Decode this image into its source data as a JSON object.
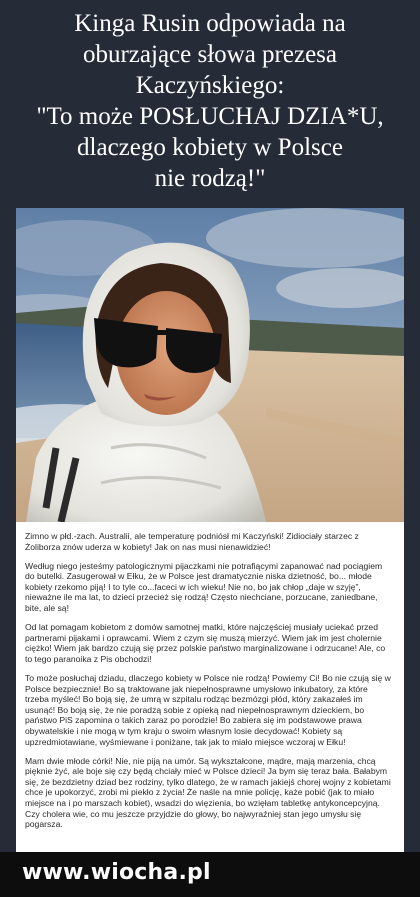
{
  "headline": {
    "lines": [
      "Kinga Rusin odpowiada na",
      "oburzające słowa prezesa",
      "Kaczyńskiego:",
      "\"To może POSŁUCHAJ DZIA*U,",
      "dlaczego kobiety w Polsce",
      "nie rodzą!\""
    ]
  },
  "post": {
    "paragraphs": [
      "Zimno w płd.-zach. Australii, ale temperaturę podniósł mi Kaczyński! Zidiociały starzec z Żoliborza znów uderza w kobiety! Jak on nas musi nienawidzieć!",
      "Według niego jesteśmy patologicznymi pijaczkami nie potrafiącymi zapanować nad pociągiem do butelki. Zasugerował w Ełku, że w Polsce jest dramatycznie niska dzietność, bo... młode kobiety rzekomo piją! I to tyle co...faceci w ich wieku! Nie no, bo jak chłop „daje w szyję”, nieważne ile ma lat, to dzieci przecież się rodzą! Często niechciane, porzucane, zaniedbane, bite, ale są!",
      "Od lat pomagam kobietom z domów samotnej matki, które najczęściej musiały uciekać przed partnerami pijakami i oprawcami. Wiem z czym się muszą mierzyć. Wiem jak im jest cholernie ciężko! Wiem jak bardzo czują się przez polskie państwo marginalizowane i odrzucane! Ale, co to tego paranoika z Pis obchodzi!",
      "To może posłuchaj dziadu, dlaczego kobiety w Polsce nie rodzą! Powiemy Ci! Bo nie czują się w Polsce bezpiecznie! Bo są traktowane jak niepełnosprawne umysłowo inkubatory, za które trzeba myśleć! Bo boją się, że umrą w szpitalu rodząc bezmózgi płód, który zakazałeś im usunąć! Bo boją się, że nie poradzą sobie z opieką nad niepełnosprawnym dzieckiem, bo państwo PiS zapomina o takich zaraz po porodzie! Bo zabiera się im podstawowe prawa obywatelskie i nie mogą w tym kraju o swoim własnym losie decydować! Kobiety są upzredmiotawiane, wyśmiewane i poniżane, tak jak to miało miejsce wczoraj w Ełku!",
      "Mam dwie młode córki! Nie, nie piją na umór. Są wykształcone, mądre, mają marzenia, chcą pięknie żyć, ale boje się czy będą chciały mieć w Polsce dzieci! Ja bym się teraz bała. Bałabym się, że bezdzietny dziad bez rodziny, tylko dlatego, że w ramach jakiejś chorej wojny z kobietami chce je upokorzyć, zrobi mi piekło z życia! Że naśle na mnie policję, każe pobić (jak to miało miejsce na i po marszach kobiet), wsadzi do więzienia, bo wzięłam tabletkę antykoncepcyjną. Czy cholera wie, co mu jeszcze przyjdzie do głowy, bo najwyraźniej stan jego umysłu się pogarsza."
    ]
  },
  "footer": {
    "brand": "www.wiocha.pl"
  },
  "colors": {
    "background": "#252c38",
    "footer": "#0d0d0d",
    "text": "#2b2b2b"
  }
}
